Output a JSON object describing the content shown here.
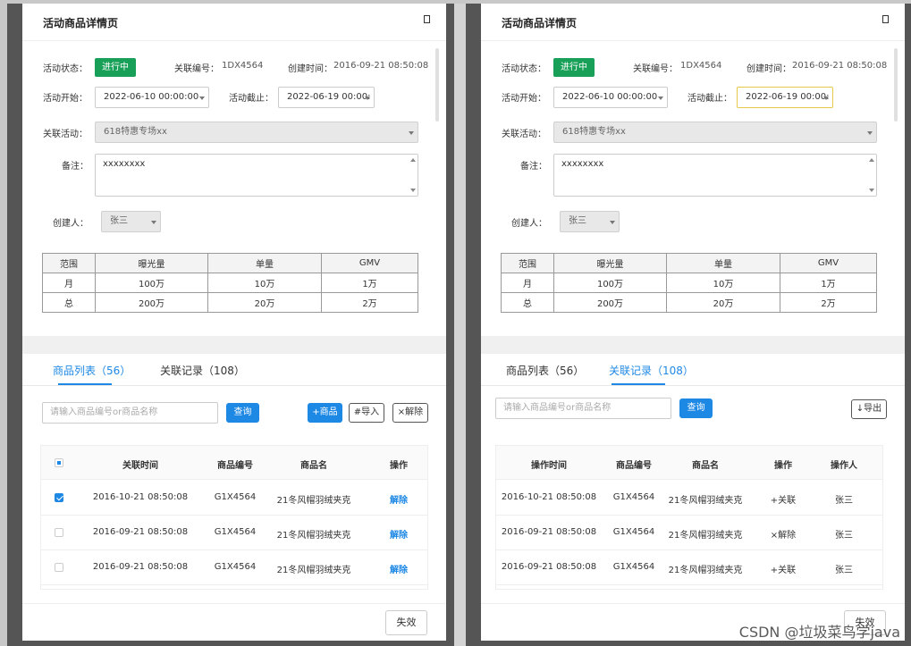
{
  "left": {
    "title": "活动商品详情页",
    "status_label": "活动状态：",
    "status_value": "进行中",
    "link_no_label": "关联编号：",
    "link_no_value": "1DX4564",
    "created_label": "创建时间：",
    "created_value": "2016-09-21  08:50:08",
    "start_label": "活动开始：",
    "start_value": "2022-06-10  00:00:00",
    "end_label": "活动截止：",
    "end_value": "2022-06-19  00:00:",
    "activity_label": "关联活动：",
    "activity_value": "618特惠专场xx",
    "note_label": "备注：",
    "note_value": "xxxxxxxx",
    "creator_label": "创建人：",
    "creator_value": "张三",
    "stats": {
      "headers": [
        "范围",
        "曝光量",
        "单量",
        "GMV"
      ],
      "rows": [
        [
          "月",
          "100万",
          "10万",
          "1万"
        ],
        [
          "总",
          "200万",
          "20万",
          "2万"
        ]
      ]
    },
    "tab_products": "商品列表（56）",
    "tab_records": "关联记录（108）",
    "search_placeholder": "请输入商品编号or商品名称",
    "query_btn": "查询",
    "add_btn": "+商品",
    "import_btn": "#导入",
    "remove_btn": "×解除",
    "grid": {
      "headers": [
        "关联时间",
        "商品编号",
        "商品名",
        "操作"
      ],
      "rows": [
        {
          "time": "2016-10-21  08:50:08",
          "code": "G1X4564",
          "name": "21冬风帽羽绒夹克",
          "op": "解除",
          "checked": true
        },
        {
          "time": "2016-09-21  08:50:08",
          "code": "G1X4564",
          "name": "21冬风帽羽绒夹克",
          "op": "解除",
          "checked": false
        },
        {
          "time": "2016-09-21  08:50:08",
          "code": "G1X4564",
          "name": "21冬风帽羽绒夹克",
          "op": "解除",
          "checked": false
        }
      ]
    },
    "footer_btn": "失效"
  },
  "right": {
    "title": "活动商品详情页",
    "status_label": "活动状态：",
    "status_value": "进行中",
    "link_no_label": "关联编号：",
    "link_no_value": "1DX4564",
    "created_label": "创建时间：",
    "created_value": "2016-09-21  08:50:08",
    "start_label": "活动开始：",
    "start_value": "2022-06-10  00:00:00",
    "end_label": "活动截止：",
    "end_value": "2022-06-19  00:00:",
    "activity_label": "关联活动：",
    "activity_value": "618特惠专场xx",
    "note_label": "备注：",
    "note_value": "xxxxxxxx",
    "creator_label": "创建人：",
    "creator_value": "张三",
    "stats": {
      "headers": [
        "范围",
        "曝光量",
        "单量",
        "GMV"
      ],
      "rows": [
        [
          "月",
          "100万",
          "10万",
          "1万"
        ],
        [
          "总",
          "200万",
          "20万",
          "2万"
        ]
      ]
    },
    "tab_products": "商品列表（56）",
    "tab_records": "关联记录（108）",
    "search_placeholder": "请输入商品编号or商品名称",
    "query_btn": "查询",
    "export_btn": "↓导出",
    "grid": {
      "headers": [
        "操作时间",
        "商品编号",
        "商品名",
        "操作",
        "操作人"
      ],
      "rows": [
        {
          "time": "2016-10-21  08:50:08",
          "code": "G1X4564",
          "name": "21冬风帽羽绒夹克",
          "op": "+关联",
          "user": "张三"
        },
        {
          "time": "2016-09-21  08:50:08",
          "code": "G1X4564",
          "name": "21冬风帽羽绒夹克",
          "op": "×解除",
          "user": "张三"
        },
        {
          "time": "2016-09-21  08:50:08",
          "code": "G1X4564",
          "name": "21冬风帽羽绒夹克",
          "op": "+关联",
          "user": "张三"
        }
      ]
    },
    "footer_btn": "失效"
  },
  "watermark": "CSDN @垃圾菜鸟学java",
  "colors": {
    "accent": "#1e88e5",
    "status_green": "#18a058",
    "focus_border": "#e6c84a"
  }
}
